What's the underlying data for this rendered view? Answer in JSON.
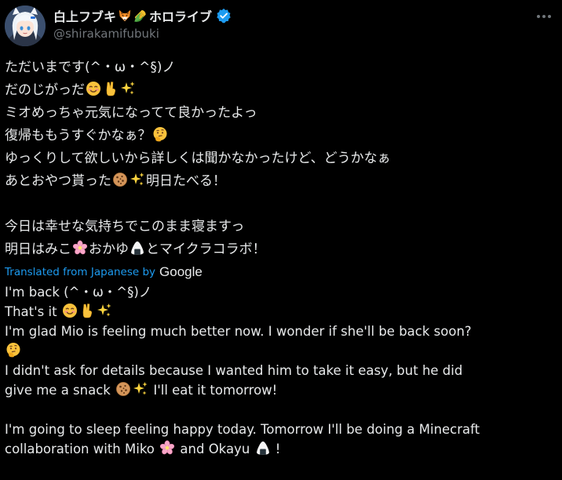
{
  "author": {
    "display_name_part1": "白上フブキ",
    "display_name_part2": "ホロライブ",
    "handle": "@shirakamifubuki",
    "name_emojis": [
      "fox-emoji",
      "corn-emoji"
    ],
    "verified_color": "#1d9bf0"
  },
  "tweet": {
    "japanese_lines": [
      [
        "ただいまです(^・ω・^§)ノ"
      ],
      [
        "だのじがっだ",
        "smiling-emoji",
        "victory-hand-emoji",
        "sparkles-emoji"
      ],
      [
        "ミオめっちゃ元気になってて良かったよっ"
      ],
      [
        "復帰ももうすぐかなぁ？",
        "thinking-emoji"
      ],
      [
        "ゆっくりして欲しいから詳しくは聞かなかったけど、どうかなぁ"
      ],
      [
        "あとおやつ貰った",
        "cookie-emoji",
        "sparkles-emoji",
        "明日たべる！"
      ],
      [],
      [
        "今日は幸せな気持ちでこのまま寝ますっ"
      ],
      [
        "明日はみこ",
        "cherry-blossom-emoji",
        "おかゆ",
        "rice-ball-emoji",
        "とマイクラコラボ！"
      ]
    ],
    "jp": {
      "l1": "ただいまです(^・ω・^§)ノ",
      "l2": "だのじがっだ",
      "l3": "ミオめっちゃ元気になってて良かったよっ",
      "l4": "復帰ももうすぐかなぁ？",
      "l5": "ゆっくりして欲しいから詳しくは聞かなかったけど、どうかなぁ",
      "l6a": "あとおやつ貰った",
      "l6b": "明日たべる！",
      "l7": "今日は幸せな気持ちでこのまま寝ますっ",
      "l8a": "明日はみこ",
      "l8b": "おかゆ",
      "l8c": "とマイクラコラボ！"
    },
    "translation": {
      "label": "Translated from Japanese by",
      "provider": "Google",
      "l1": "I'm back (^・ω・^§)ノ",
      "l2": "That's it",
      "l3": "I'm glad Mio is feeling much better now. I wonder if she'll be back soon?",
      "l5": "I didn't ask for details because I wanted him to take it easy, but he did",
      "l6a": "give me a snack",
      "l6b": "I'll eat it tomorrow!",
      "l7": "I'm going to sleep feeling happy today. Tomorrow I'll be doing a Minecraft",
      "l8a": "collaboration with Miko",
      "l8b": "and Okayu",
      "l8c": "!"
    }
  },
  "colors": {
    "background": "#000000",
    "text": "#e7e9ea",
    "secondary": "#71767b",
    "link": "#1d9bf0"
  }
}
